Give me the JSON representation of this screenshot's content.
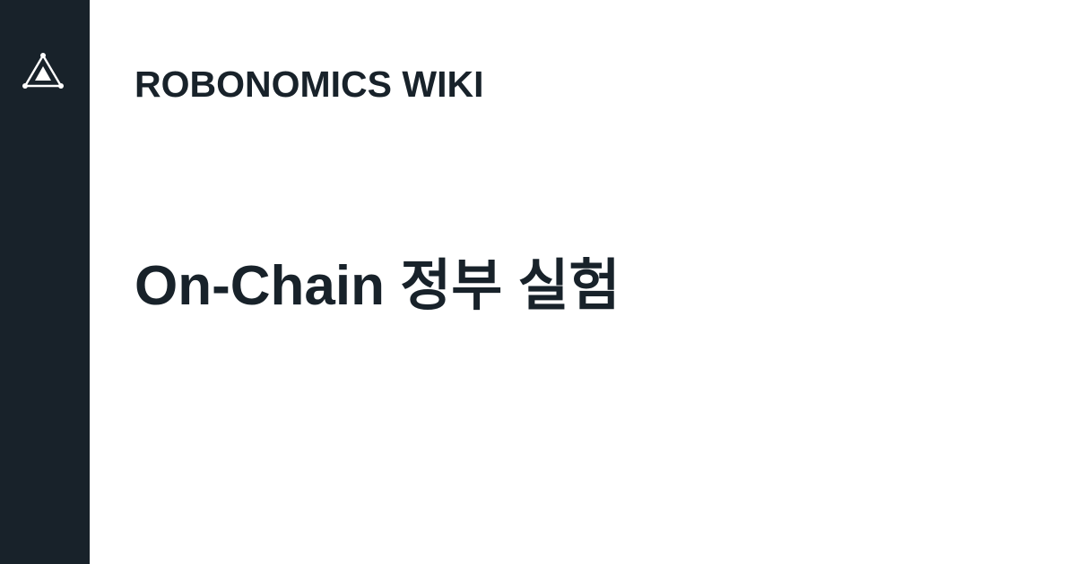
{
  "sidebar": {
    "logo_icon": "robonomics-triangle-logo-icon",
    "background_color": "#18222a"
  },
  "header": {
    "site_name": "ROBONOMICS WIKI"
  },
  "main": {
    "title": "On-Chain 정부 실험"
  },
  "colors": {
    "text": "#18222a",
    "background": "#ffffff",
    "logo": "#ffffff"
  }
}
